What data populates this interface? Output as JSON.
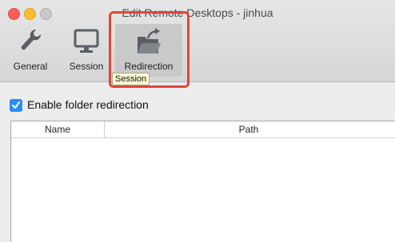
{
  "window": {
    "title": "Edit Remote Desktops - jinhua"
  },
  "toolbar": {
    "items": [
      {
        "label": "General",
        "icon": "wrench-icon"
      },
      {
        "label": "Session",
        "icon": "monitor-icon"
      },
      {
        "label": "Redirection",
        "icon": "folder-redirect-icon",
        "selected": true
      }
    ],
    "tooltip": "Session"
  },
  "redirection": {
    "enable_label": "Enable folder redirection",
    "enabled": true,
    "table": {
      "columns": [
        "Name",
        "Path"
      ],
      "rows": []
    }
  },
  "colors": {
    "accent": "#2a8df5",
    "highlight": "#e3443a"
  }
}
